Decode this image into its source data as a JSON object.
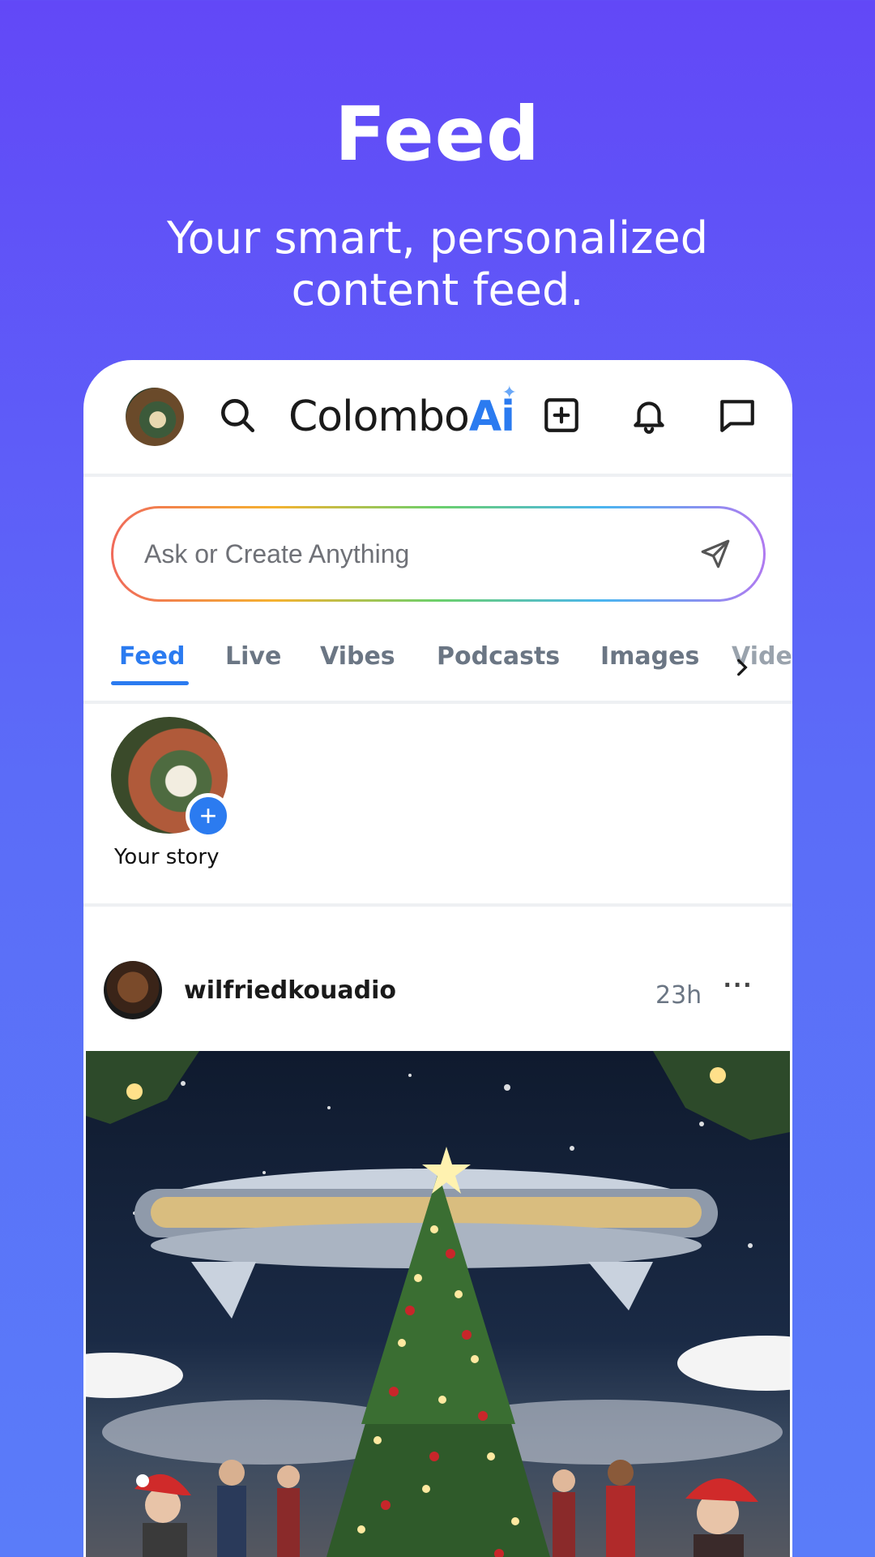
{
  "promo": {
    "title": "Feed",
    "subtitle": "Your smart, personalized content feed."
  },
  "app": {
    "logo_main": "Colombo",
    "logo_ai": "Ai",
    "search_placeholder": "Ask or Create Anything",
    "tabs": [
      {
        "label": "Feed",
        "active": true
      },
      {
        "label": "Live",
        "active": false
      },
      {
        "label": "Vibes",
        "active": false
      },
      {
        "label": "Podcasts",
        "active": false
      },
      {
        "label": "Images",
        "active": false
      },
      {
        "label": "Vide",
        "active": false
      }
    ],
    "story_label": "Your story",
    "post": {
      "username": "wilfriedkouadio",
      "time": "23h",
      "more": "···"
    }
  },
  "colors": {
    "accent": "#2b7bf0",
    "background_top": "#6248f7",
    "background_bottom": "#5a7cf9"
  },
  "icons": [
    "search-icon",
    "plus-square-icon",
    "bell-icon",
    "chat-icon",
    "send-icon",
    "chevron-right-icon",
    "plus-icon",
    "more-icon"
  ]
}
